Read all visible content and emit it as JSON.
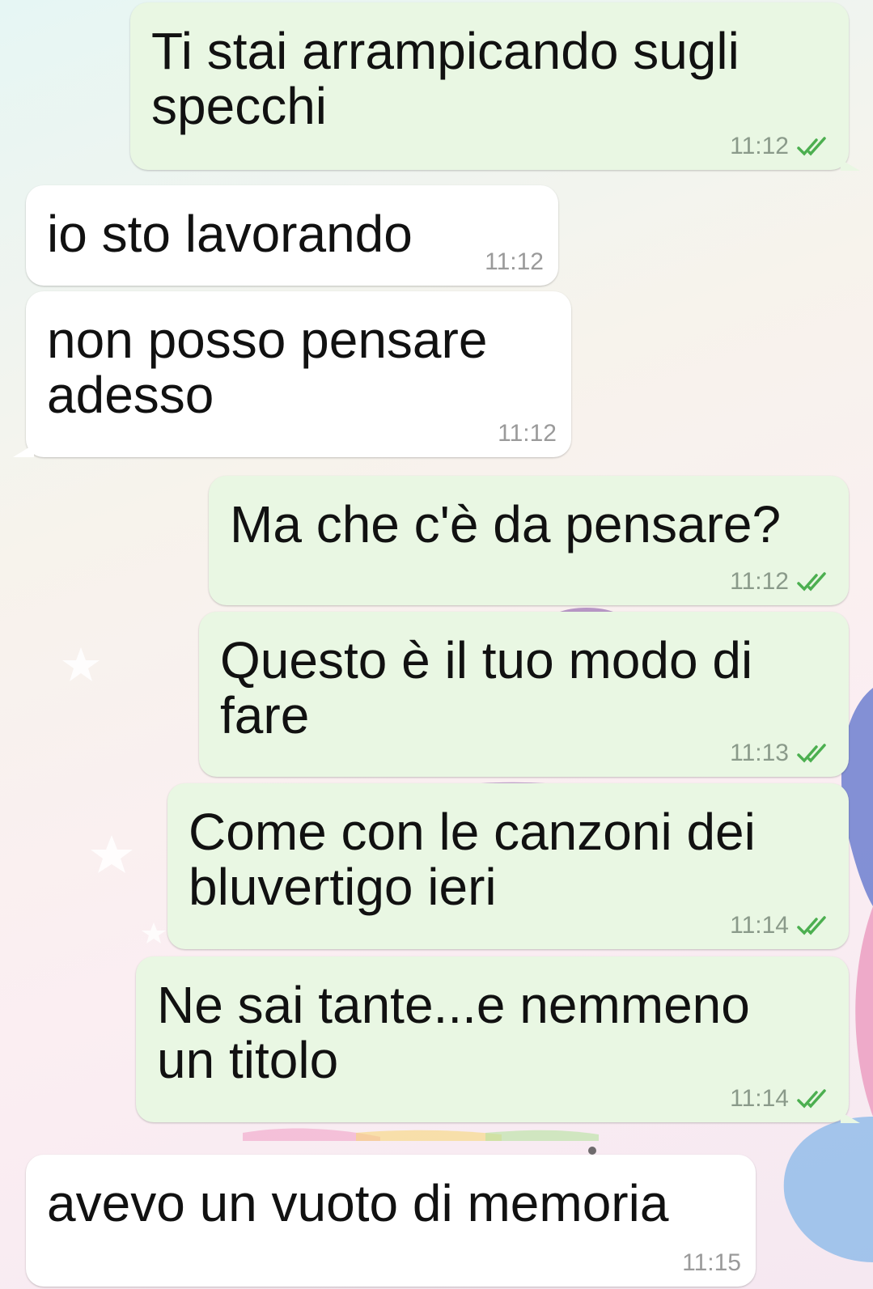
{
  "messages": [
    {
      "text": "Ti stai arrampicando sugli\nspecchi",
      "time": "11:12",
      "direction": "outgoing",
      "status": "read-double-check"
    },
    {
      "text": "io sto lavorando",
      "time": "11:12",
      "direction": "incoming"
    },
    {
      "text": "non posso pensare\nadesso",
      "time": "11:12",
      "direction": "incoming"
    },
    {
      "text": "Ma che c'è da pensare?",
      "time": "11:12",
      "direction": "outgoing",
      "status": "read-double-check"
    },
    {
      "text": "Questo è il tuo modo di\nfare",
      "time": "11:13",
      "direction": "outgoing",
      "status": "read-double-check"
    },
    {
      "text": "Come con le canzoni dei\nbluvertigo ieri",
      "time": "11:14",
      "direction": "outgoing",
      "status": "read-double-check"
    },
    {
      "text": "Ne sai tante...e nemmeno\nun titolo",
      "time": "11:14",
      "direction": "outgoing",
      "status": "read-double-check"
    },
    {
      "text": "avevo un vuoto di memoria",
      "time": "11:15",
      "direction": "incoming"
    }
  ],
  "colors": {
    "outgoing_bubble": "#e9f7e3",
    "incoming_bubble": "#ffffff",
    "read_tick": "#4caf50"
  }
}
